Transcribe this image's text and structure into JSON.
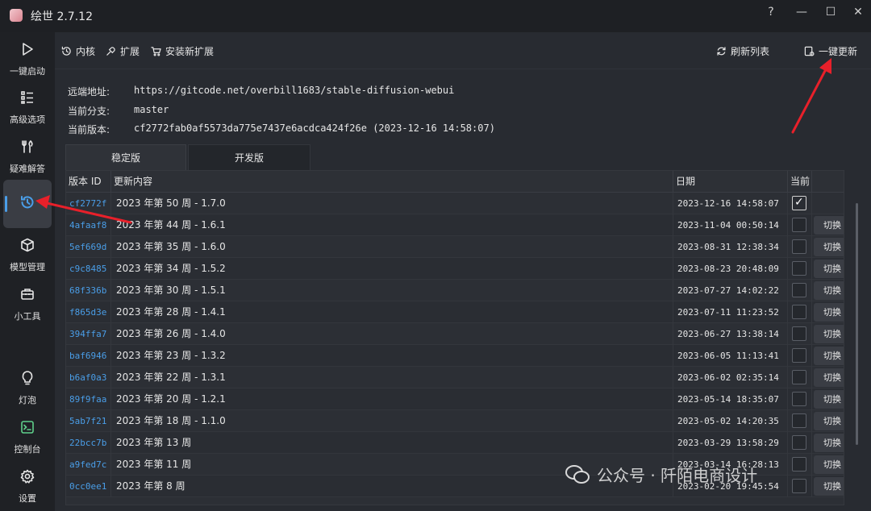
{
  "window": {
    "title": "绘世 2.7.12",
    "help_glyph": "?",
    "minimize_glyph": "—",
    "maximize_glyph": "☐",
    "close_glyph": "✕"
  },
  "sidebar": {
    "items": [
      {
        "label": "一键启动",
        "icon": "play-icon"
      },
      {
        "label": "高级选项",
        "icon": "list-icon"
      },
      {
        "label": "疑难解答",
        "icon": "tools-icon"
      },
      {
        "label": "",
        "icon": "history-icon",
        "active": true
      },
      {
        "label": "模型管理",
        "icon": "cube-icon"
      },
      {
        "label": "小工具",
        "icon": "toolbox-icon"
      },
      {
        "label": "灯泡",
        "icon": "bulb-icon"
      },
      {
        "label": "控制台",
        "icon": "terminal-icon"
      },
      {
        "label": "设置",
        "icon": "gear-icon"
      }
    ]
  },
  "toolbar": {
    "tab_core": "内核",
    "tab_ext": "扩展",
    "tab_install": "安装新扩展",
    "refresh": "刷新列表",
    "update_all": "一键更新"
  },
  "info": {
    "remote_label": "远端地址:",
    "remote_value": "https://gitcode.net/overbill1683/stable-diffusion-webui",
    "branch_label": "当前分支:",
    "branch_value": "master",
    "version_label": "当前版本:",
    "version_value": "cf2772fab0af5573da775e7437e6acdca424f26e (2023-12-16 14:58:07)"
  },
  "version_tabs": {
    "stable": "稳定版",
    "dev": "开发版"
  },
  "table": {
    "headers": {
      "id": "版本 ID",
      "desc": "更新内容",
      "date": "日期",
      "current": "当前"
    },
    "switch_label": "切换",
    "rows": [
      {
        "id": "cf2772f",
        "desc": "2023 年第 50 周 - 1.7.0",
        "date": "2023-12-16 14:58:07",
        "current": true
      },
      {
        "id": "4afaaf8",
        "desc": "2023 年第 44 周 - 1.6.1",
        "date": "2023-11-04 00:50:14",
        "current": false
      },
      {
        "id": "5ef669d",
        "desc": "2023 年第 35 周 - 1.6.0",
        "date": "2023-08-31 12:38:34",
        "current": false
      },
      {
        "id": "c9c8485",
        "desc": "2023 年第 34 周 - 1.5.2",
        "date": "2023-08-23 20:48:09",
        "current": false
      },
      {
        "id": "68f336b",
        "desc": "2023 年第 30 周 - 1.5.1",
        "date": "2023-07-27 14:02:22",
        "current": false
      },
      {
        "id": "f865d3e",
        "desc": "2023 年第 28 周 - 1.4.1",
        "date": "2023-07-11 11:23:52",
        "current": false
      },
      {
        "id": "394ffa7",
        "desc": "2023 年第 26 周 - 1.4.0",
        "date": "2023-06-27 13:38:14",
        "current": false
      },
      {
        "id": "baf6946",
        "desc": "2023 年第 23 周 - 1.3.2",
        "date": "2023-06-05 11:13:41",
        "current": false
      },
      {
        "id": "b6af0a3",
        "desc": "2023 年第 22 周 - 1.3.1",
        "date": "2023-06-02 02:35:14",
        "current": false
      },
      {
        "id": "89f9faa",
        "desc": "2023 年第 20 周 - 1.2.1",
        "date": "2023-05-14 18:35:07",
        "current": false
      },
      {
        "id": "5ab7f21",
        "desc": "2023 年第 18 周 - 1.1.0",
        "date": "2023-05-02 14:20:35",
        "current": false
      },
      {
        "id": "22bcc7b",
        "desc": "2023 年第 13 周",
        "date": "2023-03-29 13:58:29",
        "current": false
      },
      {
        "id": "a9fed7c",
        "desc": "2023 年第 11 周",
        "date": "2023-03-14 16:28:13",
        "current": false
      },
      {
        "id": "0cc0ee1",
        "desc": "2023 年第 8 周",
        "date": "2023-02-20 19:45:54",
        "current": false
      }
    ]
  },
  "watermark": {
    "text": "公众号 · 阡陌电商设计"
  },
  "colors": {
    "accent": "#4a9ee8",
    "annotation": "#e8202a"
  }
}
